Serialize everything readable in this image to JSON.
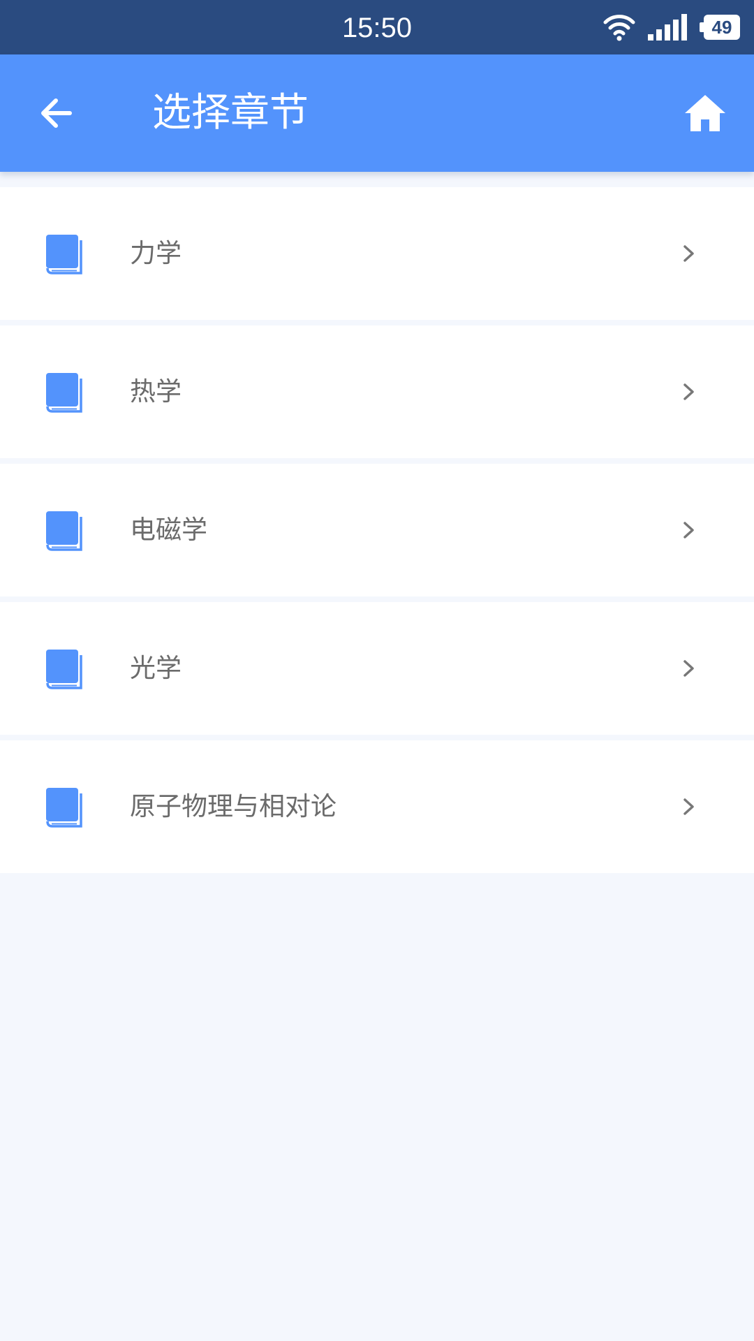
{
  "status_bar": {
    "time": "15:50",
    "battery": "49",
    "icons": [
      "wifi-icon",
      "signal-icon",
      "battery-icon"
    ],
    "background": "#2a4b80"
  },
  "header": {
    "title": "选择章节",
    "back_icon": "arrow-left-icon",
    "home_icon": "home-icon",
    "background": "#5393fc"
  },
  "chapters": [
    {
      "label": "力学",
      "icon": "book-icon"
    },
    {
      "label": "热学",
      "icon": "book-icon"
    },
    {
      "label": "电磁学",
      "icon": "book-icon"
    },
    {
      "label": "光学",
      "icon": "book-icon"
    },
    {
      "label": "原子物理与相对论",
      "icon": "book-icon"
    }
  ],
  "colors": {
    "accent": "#5393fc",
    "page_background": "#f4f7fd",
    "item_text": "#6b6b6b",
    "chevron": "#777777"
  }
}
